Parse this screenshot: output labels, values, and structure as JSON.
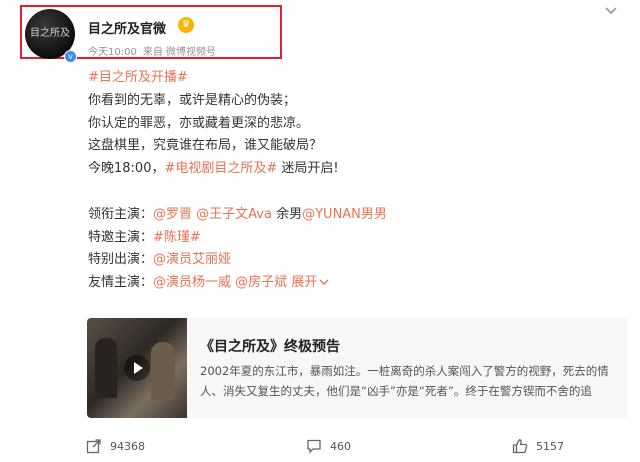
{
  "header": {
    "account_name": "目之所及官微",
    "avatar_text": "目之所及",
    "time": "今天10:00",
    "source": "来自 微博视频号"
  },
  "post": {
    "tag_title": "#目之所及开播#",
    "lines": [
      "你看到的无辜，或许是精心的伪装；",
      "你认定的罪恶，亦或藏着更深的悲凉。",
      "这盘棋里，究竟谁在布局，谁又能破局？"
    ],
    "tonight_prefix": "今晚18:00，",
    "tonight_tag": "#电视剧目之所及#",
    "tonight_suffix": " 迷局开启!",
    "cast": [
      {
        "label": "领衔主演：",
        "segments": [
          {
            "text": "@罗晋",
            "type": "mention"
          },
          {
            "text": " ",
            "type": "plain"
          },
          {
            "text": "@王子文Ava",
            "type": "mention"
          },
          {
            "text": " 余男",
            "type": "plain"
          },
          {
            "text": "@YUNAN男男",
            "type": "mention"
          }
        ]
      },
      {
        "label": "特邀主演：",
        "segments": [
          {
            "text": "#陈瑾#",
            "type": "mention"
          }
        ]
      },
      {
        "label": "特别出演：",
        "segments": [
          {
            "text": "@演员艾丽娅",
            "type": "mention"
          }
        ]
      },
      {
        "label": "友情主演：",
        "segments": [
          {
            "text": "@演员杨一威",
            "type": "mention"
          },
          {
            "text": " ",
            "type": "plain"
          },
          {
            "text": "@房子斌",
            "type": "mention"
          },
          {
            "text": "  展开",
            "type": "link"
          }
        ]
      }
    ]
  },
  "video_card": {
    "title": "《目之所及》终极预告",
    "description": "2002年夏的东江市，暴雨如注。一桩离奇的杀人案闯入了警方的视野，死去的情人、消失又复生的丈夫，他们是“凶手”亦是“死者”。终于在警方锲而不舍的追"
  },
  "footer": {
    "reposts": "94368",
    "comments": "460",
    "likes": "5157"
  },
  "colors": {
    "accent": "#eb7350",
    "highlight_box": "#e0202a"
  }
}
